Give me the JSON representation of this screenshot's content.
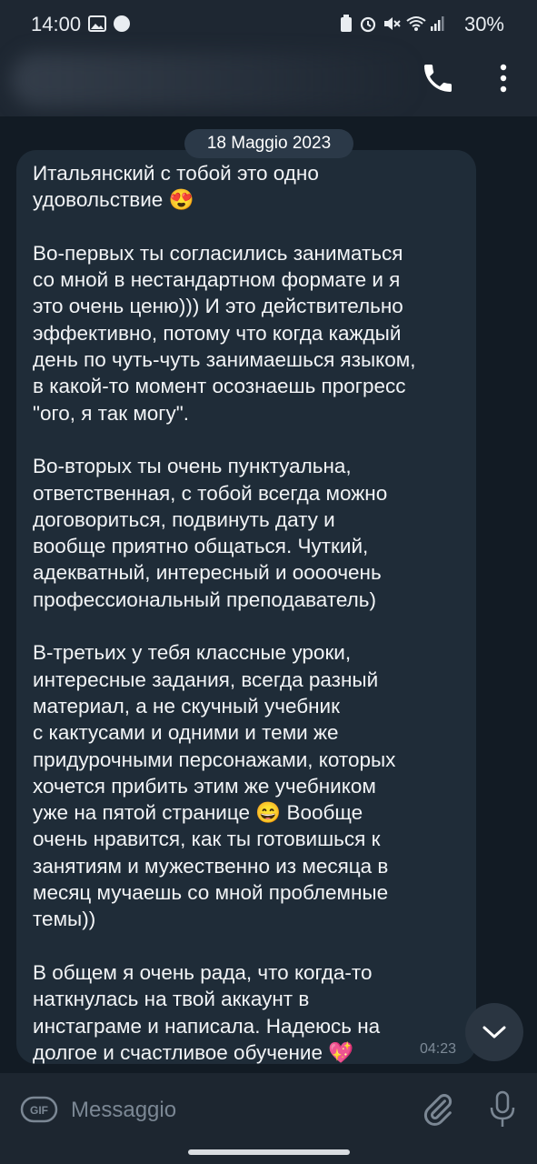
{
  "status_bar": {
    "time": "14:00",
    "notification_icons": [
      "image-icon",
      "wear-icon"
    ],
    "wear_label": "Wear",
    "system_icons": [
      "battery-saver-icon",
      "alarm-icon",
      "mute-icon",
      "wifi-icon",
      "signal-icon"
    ],
    "battery": "30%"
  },
  "header": {
    "contact_name": "",
    "actions": [
      "phone-icon",
      "more-vert-icon"
    ]
  },
  "chat": {
    "date": "18 Maggio 2023",
    "message": {
      "text": "Итальянский с тобой это одно\nудовольствие 😍\n\nВо-первых ты согласились заниматься\nсо мной в нестандартном формате и я\nэто очень ценю))) И это действительно\nэффективно, потому что когда каждый\nдень по чуть-чуть занимаешься языком,\nв какой-то момент осознаешь прогресс\n\"ого, я так могу\".\n\nВо-вторых ты очень пунктуальна,\nответственная, с тобой всегда можно\nдоговориться, подвинуть дату и\nвообще приятно общаться. Чуткий,\nадекватный, интересный и оооочень\nпрофессиональный преподаватель)\n\nВ-третьих у тебя классные уроки,\nинтересные задания, всегда разный\nматериал, а не скучный учебник\nс кактусами и одними и теми же\nпридурочными персонажами, которых\nхочется прибить этим же учебником\nуже на пятой странице 😄 Вообще\nочень нравится, как ты готовишься к\nзанятиям и мужественно из месяца в\nмесяц мучаешь со мной проблемные\nтемы))\n\nВ общем я очень рада, что когда-то\nнаткнулась на твой аккаунт в\nинстаграме и написала. Надеюсь на\nдолгое и счастливое обучение 💖",
      "time": "04:23"
    }
  },
  "composer": {
    "gif_label": "GIF",
    "placeholder": "Messaggio"
  },
  "colors": {
    "background": "#121b24",
    "bubble": "#1f2c38",
    "header": "#1e2732",
    "accent_text": "#f2f4f6"
  }
}
